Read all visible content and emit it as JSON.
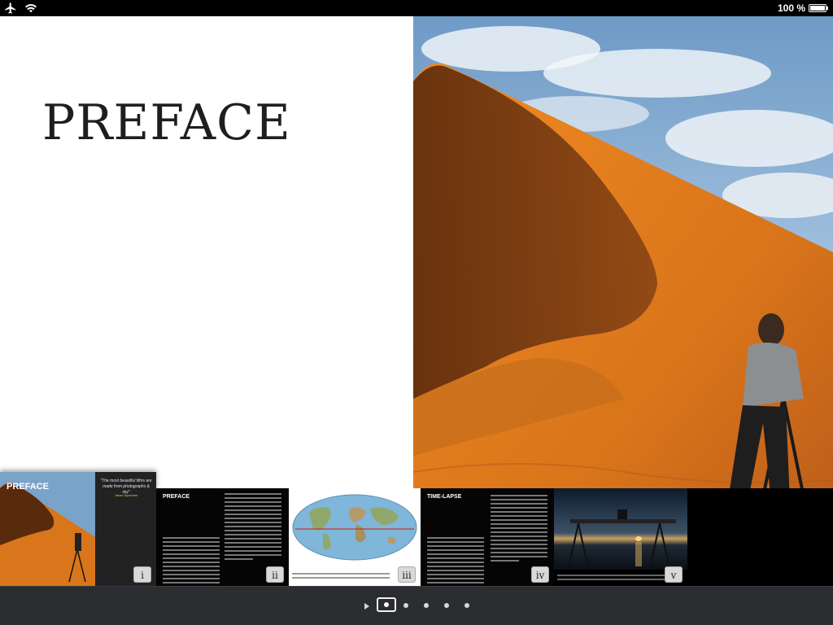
{
  "status_bar": {
    "battery_label": "100 %",
    "icons": [
      "airplane-icon",
      "wifi-icon",
      "battery-icon"
    ]
  },
  "page": {
    "title": "PREFACE"
  },
  "thumbnails": [
    {
      "badge": "i",
      "label": "PREFACE",
      "quote": "\"The most beautiful films are made from photographs & sky\"",
      "quote_author": "Jason Syncham"
    },
    {
      "badge": "ii",
      "label": "PREFACE"
    },
    {
      "badge": "iii"
    },
    {
      "badge": "iv",
      "label": "TIME-LAPSE"
    },
    {
      "badge": "v"
    }
  ],
  "page_control": {
    "page_count": 5,
    "current_index": 0,
    "play_icon": "play-icon"
  },
  "colors": {
    "status_bar": "#000000",
    "bottom_bar": "#2b2d31",
    "dune": "#d9751a"
  }
}
